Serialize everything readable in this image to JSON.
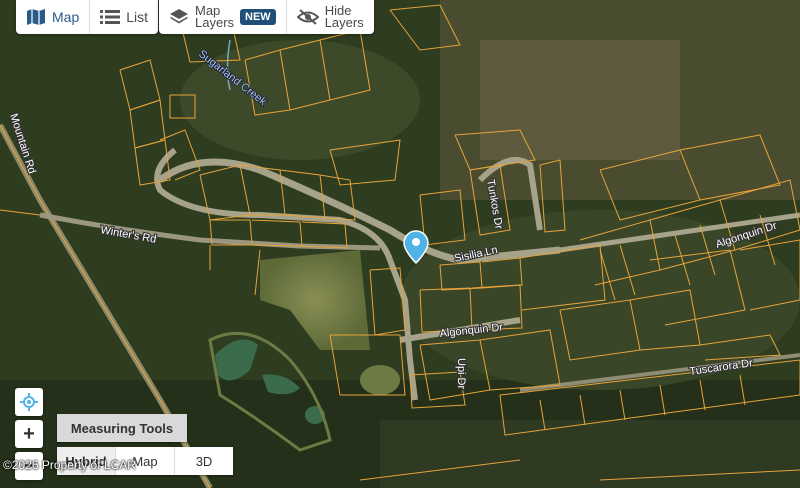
{
  "toolbar": {
    "map_label": "Map",
    "list_label": "List",
    "map_layers_line1": "Map",
    "map_layers_line2": "Layers",
    "new_badge": "NEW",
    "hide_layers_line1": "Hide",
    "hide_layers_line2": "Layers"
  },
  "roads": {
    "mountain_rd": "Mountain Rd",
    "winters_rd": "Winter's Rd",
    "sigismund_creek": "Sugarland Creek",
    "tunkos_dr": "Tunkos Dr",
    "sisilia_ln": "Sisilia Ln",
    "algonquin_dr_1": "Algonquin Dr",
    "algonquin_dr_2": "Algonquin Dr",
    "upi_dr": "Upi Dr",
    "tuscarora_dr": "Tuscarora Dr"
  },
  "controls": {
    "zoom_in": "+",
    "zoom_out": "−",
    "measuring_tools": "Measuring Tools"
  },
  "view_switch": {
    "hybrid": "Hybrid",
    "map": "Map",
    "three_d": "3D",
    "selected": "Hybrid"
  },
  "copyright": "©2026 Property of LCAR",
  "colors": {
    "parcel_lines": "#e8a33a",
    "pin": "#4fb3e8",
    "badge": "#1f4e79"
  }
}
